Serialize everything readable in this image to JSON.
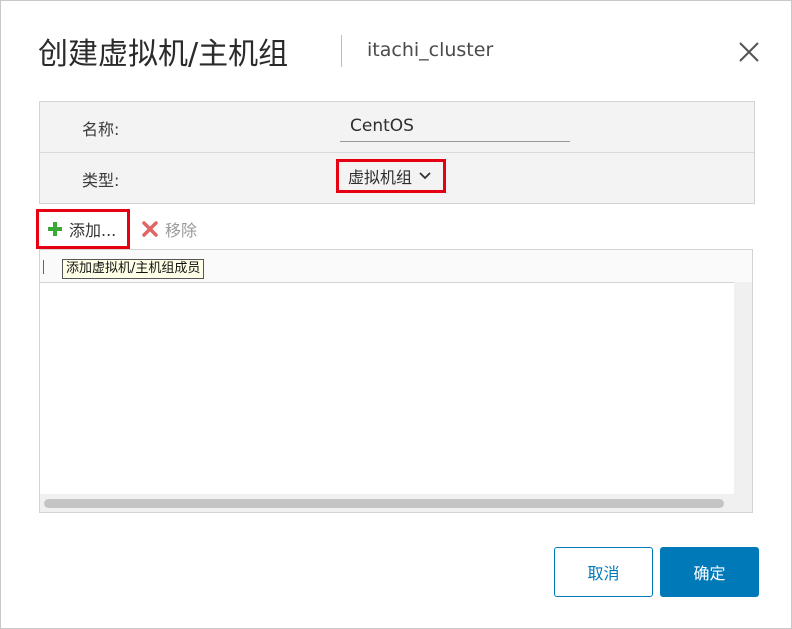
{
  "dialog": {
    "title": "创建虚拟机/主机组",
    "subtitle": "itachi_cluster",
    "close_icon": "close-icon"
  },
  "form": {
    "name_label": "名称:",
    "name_value": "CentOS",
    "type_label": "类型:",
    "type_value": "虚拟机组",
    "type_icon": "chevron-down-icon"
  },
  "toolbar": {
    "add_label": "添加...",
    "add_icon": "plus-icon",
    "remove_label": "移除",
    "remove_icon": "x-icon"
  },
  "grid": {
    "tooltip": "添加虚拟机/主机组成员"
  },
  "footer": {
    "cancel_label": "取消",
    "ok_label": "确定"
  },
  "colors": {
    "accent": "#0079b8",
    "highlight": "#e60012",
    "add_green": "#3aa935",
    "remove_red": "#e06666"
  }
}
